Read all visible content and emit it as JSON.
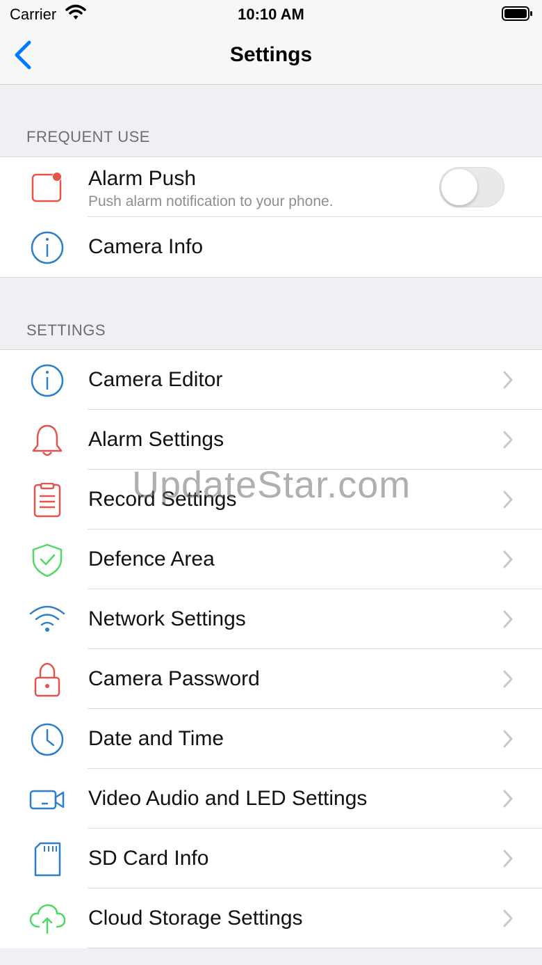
{
  "status_bar": {
    "carrier": "Carrier",
    "time": "10:10 AM"
  },
  "nav": {
    "title": "Settings"
  },
  "sections": {
    "frequent": {
      "header": "FREQUENT USE",
      "alarm_push": {
        "label": "Alarm Push",
        "sub": "Push alarm notification to your phone.",
        "enabled": false
      },
      "camera_info": {
        "label": "Camera Info"
      }
    },
    "settings": {
      "header": "SETTINGS",
      "items": [
        {
          "label": "Camera Editor",
          "icon": "info-icon",
          "color": "#2d7fc9"
        },
        {
          "label": "Alarm Settings",
          "icon": "bell-icon",
          "color": "#e5534b"
        },
        {
          "label": "Record Settings",
          "icon": "clipboard-icon",
          "color": "#e5534b"
        },
        {
          "label": "Defence Area",
          "icon": "shield-check-icon",
          "color": "#4cd964"
        },
        {
          "label": "Network Settings",
          "icon": "wifi-icon",
          "color": "#2d7fc9"
        },
        {
          "label": "Camera Password",
          "icon": "lock-icon",
          "color": "#e5534b"
        },
        {
          "label": "Date and Time",
          "icon": "clock-icon",
          "color": "#2d7fc9"
        },
        {
          "label": "Video Audio and LED Settings",
          "icon": "video-camera-icon",
          "color": "#2d7fc9"
        },
        {
          "label": "SD Card Info",
          "icon": "sd-card-icon",
          "color": "#2d7fc9"
        },
        {
          "label": "Cloud Storage Settings",
          "icon": "cloud-upload-icon",
          "color": "#4cd964"
        }
      ]
    }
  },
  "watermark": "UpdateStar.com",
  "colors": {
    "accent": "#007aff",
    "red": "#e5534b",
    "blue": "#2d7fc9",
    "green": "#4cd964"
  }
}
